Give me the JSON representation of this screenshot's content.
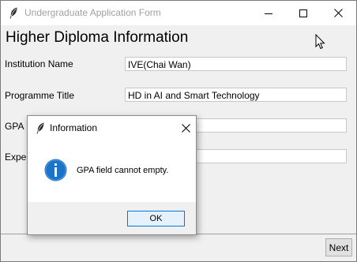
{
  "window": {
    "title": "Undergraduate Application Form",
    "controls": {
      "minimize": "minimize-icon",
      "maximize": "maximize-icon",
      "close": "close-icon"
    }
  },
  "form": {
    "heading": "Higher Diploma Information",
    "fields": [
      {
        "label": "Institution Name",
        "value": "IVE(Chai Wan)"
      },
      {
        "label": "Programme Title",
        "value": "HD in AI and Smart Technology"
      },
      {
        "label": "GPA",
        "value": ""
      },
      {
        "label": "Expec",
        "value": ""
      }
    ],
    "next_label": "Next"
  },
  "dialog": {
    "title": "Information",
    "message": "GPA field cannot empty.",
    "ok_label": "OK",
    "icon": "info-icon"
  },
  "colors": {
    "accent": "#0078d7",
    "info_icon": "#1a73c8",
    "title_text_inactive": "#a0a0a0"
  }
}
